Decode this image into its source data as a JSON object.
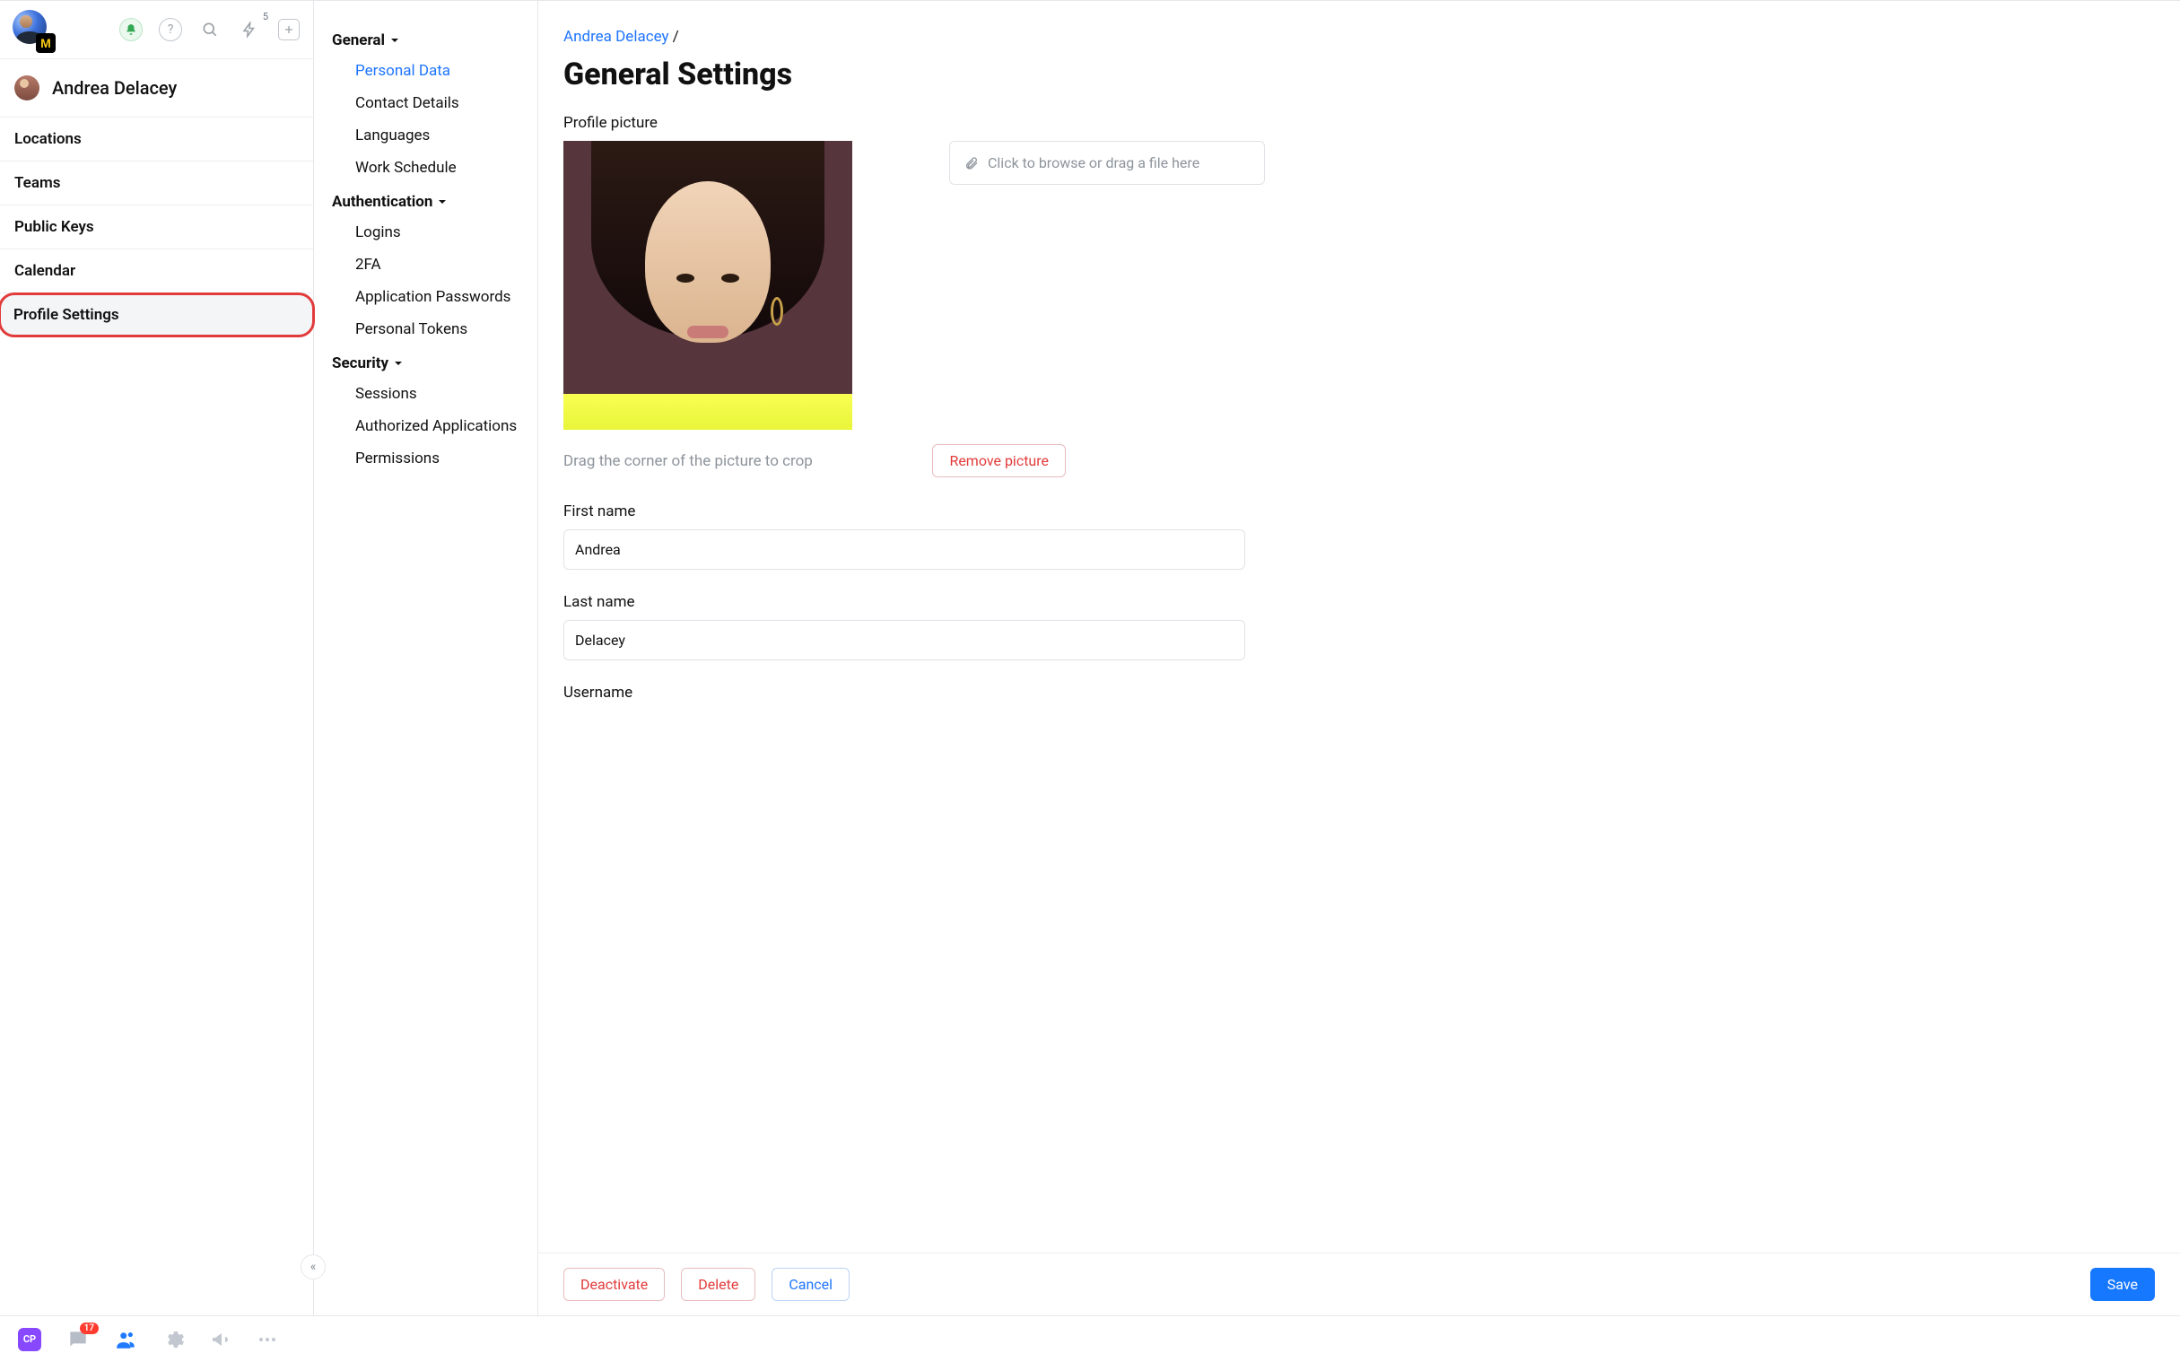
{
  "header": {
    "overlay_letter": "M",
    "lightning_badge": "5"
  },
  "person": {
    "name": "Andrea Delacey"
  },
  "leftNav": {
    "items": [
      {
        "label": "Locations"
      },
      {
        "label": "Teams"
      },
      {
        "label": "Public Keys"
      },
      {
        "label": "Calendar"
      },
      {
        "label": "Profile Settings"
      }
    ]
  },
  "settingsNav": {
    "general": {
      "title": "General",
      "items": [
        "Personal Data",
        "Contact Details",
        "Languages",
        "Work Schedule"
      ]
    },
    "authentication": {
      "title": "Authentication",
      "items": [
        "Logins",
        "2FA",
        "Application Passwords",
        "Personal Tokens"
      ]
    },
    "security": {
      "title": "Security",
      "items": [
        "Sessions",
        "Authorized Applications",
        "Permissions"
      ]
    }
  },
  "breadcrumb": {
    "name": "Andrea Delacey",
    "sep": "/"
  },
  "page": {
    "title": "General Settings",
    "picture_label": "Profile picture",
    "dropzone_text": "Click to browse or drag a file here",
    "crop_hint": "Drag the corner of the picture to crop",
    "remove_picture": "Remove picture",
    "first_name_label": "First name",
    "first_name_value": "Andrea",
    "last_name_label": "Last name",
    "last_name_value": "Delacey",
    "username_label": "Username"
  },
  "footer": {
    "deactivate": "Deactivate",
    "delete": "Delete",
    "cancel": "Cancel",
    "save": "Save"
  },
  "bottombar": {
    "cp": "CP",
    "chat_badge": "17"
  }
}
